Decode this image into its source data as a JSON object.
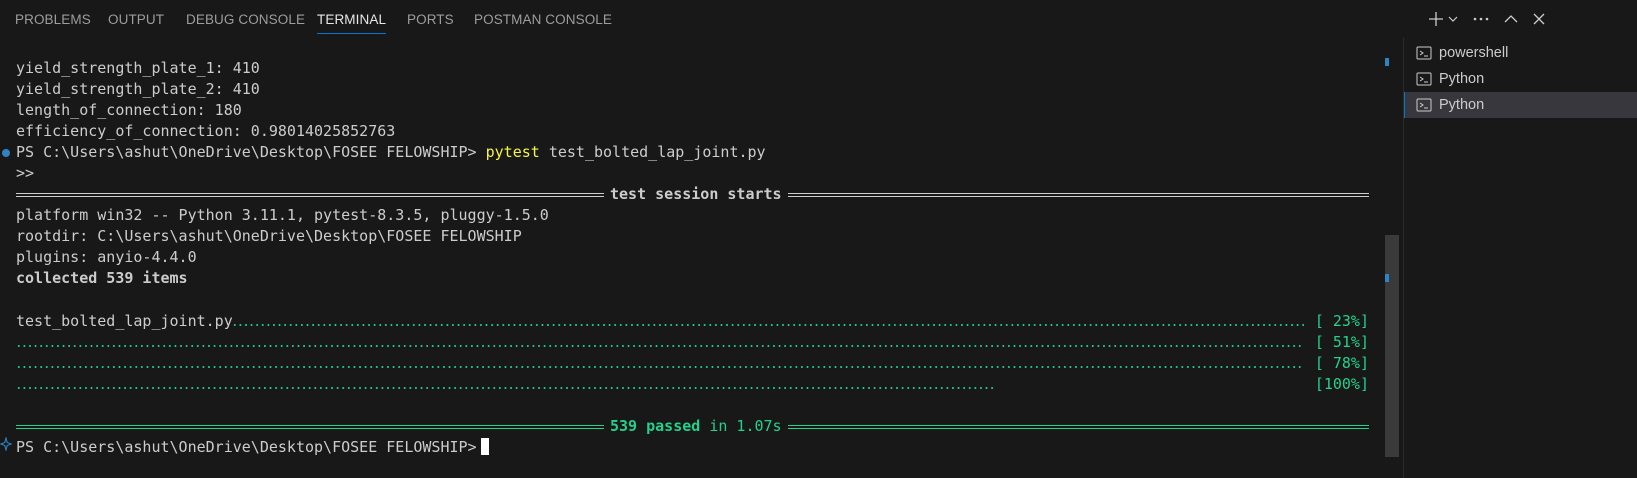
{
  "tabs": [
    {
      "label": "PROBLEMS",
      "active": false
    },
    {
      "label": "OUTPUT",
      "active": false
    },
    {
      "label": "DEBUG CONSOLE",
      "active": false
    },
    {
      "label": "TERMINAL",
      "active": true
    },
    {
      "label": "PORTS",
      "active": false
    },
    {
      "label": "POSTMAN CONSOLE",
      "active": false
    }
  ],
  "toolbar_icons": [
    "plus-icon",
    "chevron-down-icon",
    "more-icon",
    "chevron-up-icon",
    "close-icon"
  ],
  "terminal": {
    "output_lines": [
      "yield_strength_plate_1: 410",
      "yield_strength_plate_2: 410",
      "length_of_connection: 180",
      "efficiency_of_connection: 0.98014025852763"
    ],
    "prompt": "PS C:\\Users\\ashut\\OneDrive\\Desktop\\FOSEE FELOWSHIP>",
    "command_name": "pytest",
    "command_arg": " test_bolted_lap_joint.py",
    "continuation": ">>",
    "session_header": "test session starts",
    "platform_line": "platform win32 -- Python 3.11.1, pytest-8.3.5, pluggy-1.5.0",
    "rootdir_line": "rootdir: C:\\Users\\ashut\\OneDrive\\Desktop\\FOSEE FELOWSHIP",
    "plugins_line": "plugins: anyio-4.4.0",
    "collected_line": "collected 539 items",
    "test_file": "test_bolted_lap_joint.py",
    "progress": [
      "[ 23%]",
      "[ 51%]",
      "[ 78%]",
      "[100%]"
    ],
    "summary_passed": "539 passed",
    "summary_time": " in 1.07s",
    "final_prompt": "PS C:\\Users\\ashut\\OneDrive\\Desktop\\FOSEE FELOWSHIP>"
  },
  "terminal_list": [
    {
      "label": "powershell",
      "active": false
    },
    {
      "label": "Python",
      "active": false
    },
    {
      "label": "Python",
      "active": true
    }
  ],
  "colors": {
    "background": "#181818",
    "accent": "#0078d4",
    "pass_green": "#23d18b",
    "command_yellow": "#f5f543"
  }
}
